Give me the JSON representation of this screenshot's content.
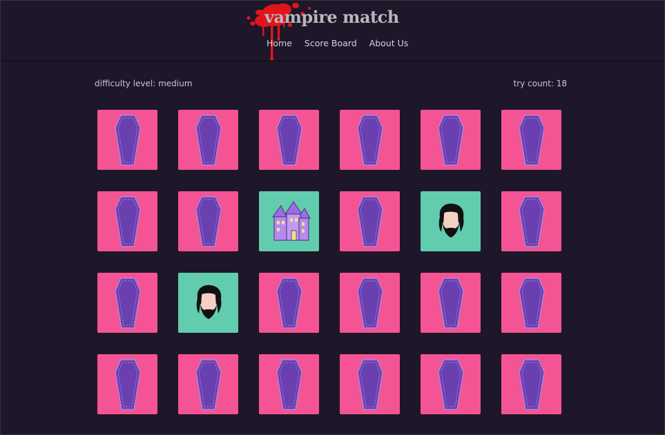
{
  "site": {
    "title": "vampire match"
  },
  "nav": {
    "items": [
      {
        "label": "Home"
      },
      {
        "label": "Score Board"
      },
      {
        "label": "About Us"
      }
    ]
  },
  "status": {
    "difficulty": "difficulty level: medium",
    "try_count": "try count: 18"
  },
  "colors": {
    "background": "#1e1629",
    "card_back": "#f45493",
    "card_face": "#62cdae",
    "coffin": "#6a3fb0",
    "blood": "#e0141c"
  },
  "board": {
    "columns": 6,
    "rows": 4,
    "cards": [
      {
        "state": "hidden",
        "icon": "coffin-icon"
      },
      {
        "state": "hidden",
        "icon": "coffin-icon"
      },
      {
        "state": "hidden",
        "icon": "coffin-icon"
      },
      {
        "state": "hidden",
        "icon": "coffin-icon"
      },
      {
        "state": "hidden",
        "icon": "coffin-icon"
      },
      {
        "state": "hidden",
        "icon": "coffin-icon"
      },
      {
        "state": "hidden",
        "icon": "coffin-icon"
      },
      {
        "state": "hidden",
        "icon": "coffin-icon"
      },
      {
        "state": "revealed",
        "icon": "haunted-house-icon"
      },
      {
        "state": "hidden",
        "icon": "coffin-icon"
      },
      {
        "state": "revealed",
        "icon": "bearded-vampire-icon"
      },
      {
        "state": "hidden",
        "icon": "coffin-icon"
      },
      {
        "state": "hidden",
        "icon": "coffin-icon"
      },
      {
        "state": "revealed",
        "icon": "bearded-vampire-icon"
      },
      {
        "state": "hidden",
        "icon": "coffin-icon"
      },
      {
        "state": "hidden",
        "icon": "coffin-icon"
      },
      {
        "state": "hidden",
        "icon": "coffin-icon"
      },
      {
        "state": "hidden",
        "icon": "coffin-icon"
      },
      {
        "state": "hidden",
        "icon": "coffin-icon"
      },
      {
        "state": "hidden",
        "icon": "coffin-icon"
      },
      {
        "state": "hidden",
        "icon": "coffin-icon"
      },
      {
        "state": "hidden",
        "icon": "coffin-icon"
      },
      {
        "state": "hidden",
        "icon": "coffin-icon"
      },
      {
        "state": "hidden",
        "icon": "coffin-icon"
      }
    ]
  }
}
